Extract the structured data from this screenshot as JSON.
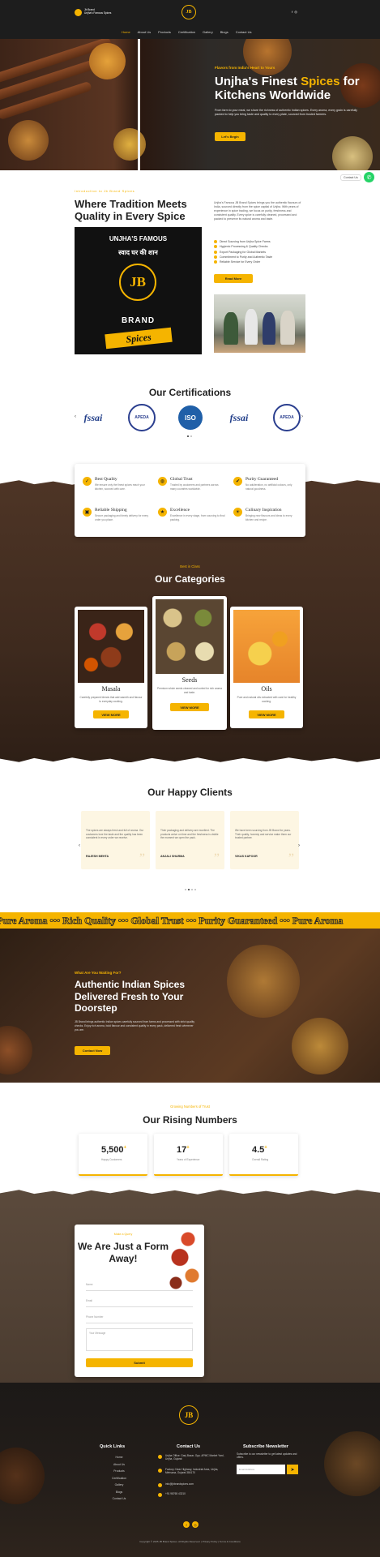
{
  "header": {
    "brand_line1": "Jb Brand",
    "brand_line2": "Unjha's Famous Spices",
    "emblem": "JB",
    "icons": [
      "facebook-icon",
      "instagram-icon"
    ],
    "nav": [
      "Home",
      "About Us",
      "Products",
      "Certification",
      "Gallery",
      "Blogs",
      "Contact Us"
    ],
    "active_nav": "Home"
  },
  "hero": {
    "kicker": "Flavors from India's Heart to Yours",
    "title_part1": "Unjha's Finest ",
    "title_highlight": "Spices",
    "title_part2": " for Kitchens Worldwide",
    "description": "From farm to your meal, we share the richness of authentic Indian spices. Every aroma, every grain is carefully packed to help you bring taste and quality to every plate, sourced from trusted farmers.",
    "button": "Let's Begin"
  },
  "intro": {
    "kicker": "Introduction to Jb Brand Spices",
    "title": "Where Tradition Meets Quality in Every Spice",
    "badge": {
      "top": "UNJHA'S FAMOUS",
      "hindi": "स्वाद घर की शान",
      "emblem": "JB",
      "brand": "BRAND",
      "spices": "Spices"
    },
    "description": "Unjha's Famous JB Brand Spices brings you the authentic flavours of India, sourced directly from the spice capital of Unjha. With years of experience in spice trading, we focus on purity, freshness and consistent quality. Every spice is carefully cleaned, processed and packed to preserve its natural aroma and taste.",
    "checks": [
      "Direct Sourcing from Unjha Spice Farms",
      "Hygienic Processing & Quality Checks",
      "Export Packaging for Global Markets",
      "Commitment to Purity and Authentic Taste",
      "Reliable Service for Every Order"
    ],
    "button": "Read More"
  },
  "floating": {
    "contact_label": "Contact Us",
    "whatsapp_icon": "whatsapp-icon"
  },
  "certifications": {
    "title": "Our Certifications",
    "items": [
      "fssai",
      "APEDA",
      "ISO",
      "fssai",
      "APEDA"
    ]
  },
  "features": [
    {
      "icon": "check-icon",
      "title": "Best Quality",
      "desc": "We ensure only the finest spices reach your kitchen, sourced with care."
    },
    {
      "icon": "globe-icon",
      "title": "Global Trust",
      "desc": "Trusted by customers and partners across many countries worldwide."
    },
    {
      "icon": "badge-check-icon",
      "title": "Purity Guaranteed",
      "desc": "No adulteration, no artificial colours, only natural goodness."
    },
    {
      "icon": "truck-icon",
      "title": "Reliable Shipping",
      "desc": "Secure packaging and timely delivery for every order you place."
    },
    {
      "icon": "star-icon",
      "title": "Excellence",
      "desc": "Excellence in every stage, from sourcing to final packing."
    },
    {
      "icon": "bulb-icon",
      "title": "Culinary Inspiration",
      "desc": "Bringing new flavours and ideas to every kitchen and recipe."
    }
  ],
  "categories": {
    "kicker": "Best in Class",
    "title": "Our Categories",
    "items": [
      {
        "name": "Masala",
        "desc": "Carefully prepared blends that add warmth and flavour to everyday cooking.",
        "button": "VIEW MORE"
      },
      {
        "name": "Seeds",
        "desc": "Premium whole seeds cleaned and sorted for rich aroma and taste.",
        "button": "VIEW MORE"
      },
      {
        "name": "Oils",
        "desc": "Pure and natural oils extracted with care for healthy cooking.",
        "button": "VIEW MORE"
      }
    ]
  },
  "clients": {
    "title": "Our Happy Clients",
    "items": [
      {
        "quote": "The spices are always fresh and full of aroma. Our customers love the taste and the quality has been consistent in every order we receive.",
        "name": "RAJESH MEHTA"
      },
      {
        "quote": "Their packaging and delivery are excellent. The products arrive on time and the freshness is visible the moment we open the pack.",
        "name": "ANJALI SHARMA"
      },
      {
        "quote": "We have been sourcing from JB Brand for years. Their quality, honesty and service make them our trusted partner.",
        "name": "VIKAS KAPOOR"
      }
    ]
  },
  "marquee": {
    "text": "Pure Aroma  •••  Rich Quality  •••  Global Trust  •••  Purity Guaranteed  •••  Pure Aroma"
  },
  "cta": {
    "kicker": "What Are You Waiting For?",
    "title": "Authentic Indian Spices Delivered Fresh to Your Doorstep",
    "description": "JB Brand brings authentic Indian spices carefully sourced from farms and processed with strict quality checks. Enjoy rich aroma, bold flavour and consistent quality in every pack, delivered fresh wherever you are.",
    "button": "Contact Now"
  },
  "numbers": {
    "kicker": "Growing Numbers of Trust",
    "title": "Our Rising Numbers",
    "items": [
      {
        "value": "5,500",
        "suffix": "+",
        "label": "Happy Customers"
      },
      {
        "value": "17",
        "suffix": "+",
        "label": "Years of Experience"
      },
      {
        "value": "4.5",
        "suffix": "+",
        "label": "Overall Rating"
      }
    ]
  },
  "form": {
    "kicker": "Make a Query",
    "title": "We Are Just a Form Away!",
    "fields": {
      "name": "Name",
      "email": "Email",
      "phone": "Phone Number",
      "message": "Your Message"
    },
    "submit": "Submit"
  },
  "footer": {
    "emblem": "JB",
    "quick_links_title": "Quick Links",
    "quick_links": [
      "Home",
      "About Us",
      "Products",
      "Certification",
      "Gallery",
      "Blogs",
      "Contact Us"
    ],
    "contact_title": "Contact Us",
    "contact": [
      {
        "icon": "location-icon",
        "text": "Unjha Office: Ganj Bazar, Opp. APMC Market Yard, Unjha, Gujarat"
      },
      {
        "icon": "location-icon",
        "text": "Factory: Near Highway, Industrial Area, Unjha, Mehsana, Gujarat 384170"
      },
      {
        "icon": "mail-icon",
        "text": "info@jbbrandspices.com"
      },
      {
        "icon": "phone-icon",
        "text": "+91 98765 43210"
      }
    ],
    "newsletter_title": "Subscribe Newsletter",
    "newsletter_desc": "Subscribe to our newsletter to get latest updates and offers.",
    "newsletter_placeholder": "Email Address",
    "social": [
      "facebook-icon",
      "instagram-icon"
    ],
    "copyright": "Copyright © 2025 JB Brand Spices. All Rights Reserved. | Privacy Policy | Terms & Conditions"
  }
}
